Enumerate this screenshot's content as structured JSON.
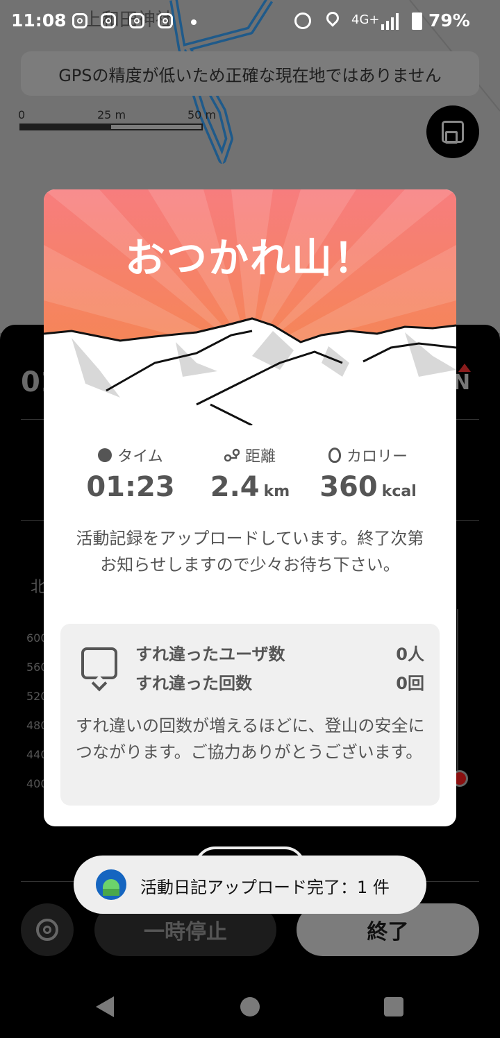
{
  "status_bar": {
    "time": "11:08",
    "network": "4G+",
    "battery": "79%"
  },
  "map": {
    "label_fragment": "上和田神社",
    "gps_warning": "GPSの精度が低いため正確な現在地ではありません",
    "scale": {
      "zero": "0",
      "mid": "25 m",
      "max": "50 m"
    }
  },
  "panel": {
    "time_fragment": "01",
    "compass": "N",
    "north_fragment": "北",
    "y_ticks": [
      "600",
      "560",
      "520",
      "480",
      "440",
      "400"
    ]
  },
  "modal": {
    "title": "おつかれ山！",
    "stats": [
      {
        "label": "タイム",
        "value": "01:23",
        "unit": ""
      },
      {
        "label": "距離",
        "value": "2.4",
        "unit": "km"
      },
      {
        "label": "カロリー",
        "value": "360",
        "unit": "kcal"
      }
    ],
    "upload_message": "活動記録をアップロードしています。終了次第お知らせしますので少々お待ち下さい。",
    "encounter": {
      "users_label": "すれ違ったユーザ数",
      "users_value": "0人",
      "count_label": "すれ違った回数",
      "count_value": "0回",
      "note": "すれ違いの回数が増えるほどに、登山の安全につながります。ご協力ありがとうございます。"
    }
  },
  "toast": {
    "text": "活動日記アップロード完了：1 件"
  },
  "controls": {
    "pause_label": "一時停止",
    "end_label": "終了"
  },
  "colors": {
    "header_top": "#f77d7e",
    "header_bottom": "#f2894a",
    "route_line": "#1f5a8a"
  }
}
